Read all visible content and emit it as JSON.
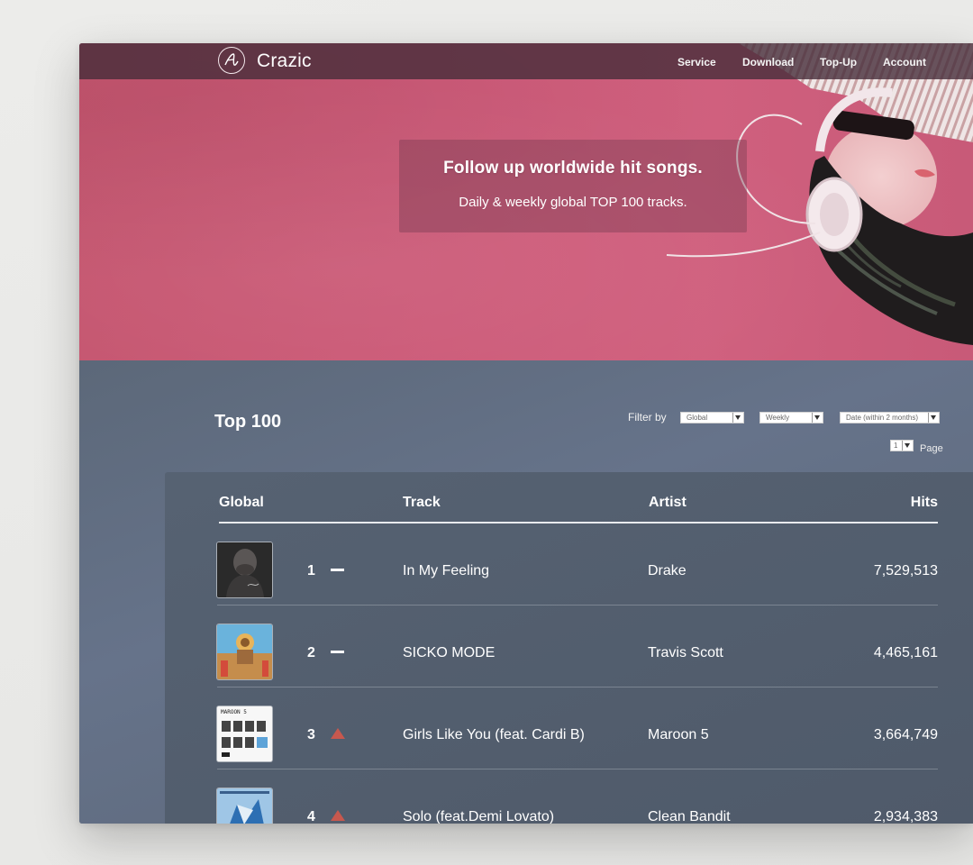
{
  "brand": {
    "name": "Crazic"
  },
  "nav": {
    "items": [
      {
        "label": "Service"
      },
      {
        "label": "Download"
      },
      {
        "label": "Top-Up"
      },
      {
        "label": "Account"
      }
    ]
  },
  "hero": {
    "title": "Follow up worldwide hit songs.",
    "subtitle": "Daily & weekly global TOP 100 tracks.",
    "background_color": "#cc5a78"
  },
  "chart": {
    "title": "Top 100",
    "filter_label": "Filter by",
    "filters": {
      "region": "Global",
      "period": "Weekly",
      "date": "Date (within 2 months)"
    },
    "page": {
      "value": "1",
      "label": "Page"
    }
  },
  "table": {
    "headers": {
      "rank": "Global",
      "track": "Track",
      "artist": "Artist",
      "hits": "Hits"
    },
    "rows": [
      {
        "rank": "1",
        "change": "same",
        "track": "In My Feeling",
        "artist": "Drake",
        "hits": "7,529,513"
      },
      {
        "rank": "2",
        "change": "same",
        "track": "SICKO MODE",
        "artist": "Travis Scott",
        "hits": "4,465,161"
      },
      {
        "rank": "3",
        "change": "up",
        "track": "Girls Like You (feat. Cardi B)",
        "artist": "Maroon 5",
        "hits": "3,664,749",
        "cover_text": "MAROON 5"
      },
      {
        "rank": "4",
        "change": "up",
        "track": "Solo (feat.Demi Lovato)",
        "artist": "Clean Bandit",
        "hits": "2,934,383"
      }
    ]
  },
  "colors": {
    "accent_up": "#c7584e",
    "content_bg": "#5e6b7b",
    "nav_bg": "#46303a"
  }
}
